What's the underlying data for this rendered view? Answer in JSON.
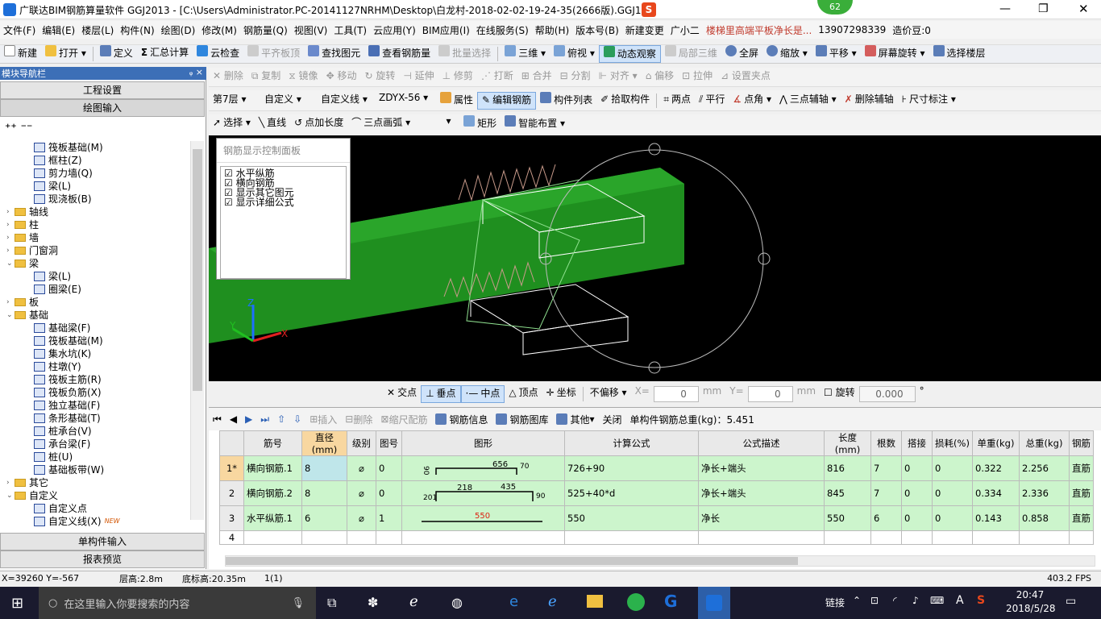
{
  "window": {
    "title": "广联达BIM钢筋算量软件 GGJ2013 - [C:\\Users\\Administrator.PC-20141127NRHM\\Desktop\\白龙村-2018-02-02-19-24-35(2666版).GGJ12]",
    "badge": "62"
  },
  "menu": [
    "文件(F)",
    "编辑(E)",
    "楼层(L)",
    "构件(N)",
    "绘图(D)",
    "修改(M)",
    "钢筋量(Q)",
    "视图(V)",
    "工具(T)",
    "云应用(Y)",
    "BIM应用(I)",
    "在线服务(S)",
    "帮助(H)",
    "版本号(B)",
    "新建变更",
    "广小二",
    "楼梯里高端平板净长是...",
    "13907298339",
    "造价豆:0"
  ],
  "toolbar1": [
    "新建",
    "打开",
    "定义",
    "汇总计算",
    "云检查",
    "平齐板顶",
    "查找图元",
    "查看钢筋量",
    "批量选择",
    "三维",
    "俯视",
    "动态观察",
    "局部三维",
    "全屏",
    "缩放",
    "平移",
    "屏幕旋转",
    "选择楼层"
  ],
  "toolbar2": [
    "删除",
    "复制",
    "镜像",
    "移动",
    "旋转",
    "延伸",
    "修剪",
    "打断",
    "合并",
    "分割",
    "对齐",
    "偏移",
    "拉伸",
    "设置夹点"
  ],
  "toolbar3": {
    "floor": "第7层",
    "type1": "自定义",
    "type2": "自定义线",
    "code": "ZDYX-56",
    "items": [
      "属性",
      "编辑钢筋",
      "构件列表",
      "拾取构件",
      "两点",
      "平行",
      "点角",
      "三点辅轴",
      "删除辅轴",
      "尺寸标注"
    ]
  },
  "toolbar4": [
    "选择",
    "直线",
    "点加长度",
    "三点画弧",
    "矩形",
    "智能布置"
  ],
  "leftpanel": {
    "header": "模块导航栏",
    "pin": "ᵩ ×",
    "tabs": [
      "工程设置",
      "绘图输入",
      "单构件输入",
      "报表预览"
    ],
    "tree": [
      {
        "label": "筏板基础(M)",
        "lvl": 3,
        "type": "leaf"
      },
      {
        "label": "框柱(Z)",
        "lvl": 3,
        "type": "leaf"
      },
      {
        "label": "剪力墙(Q)",
        "lvl": 3,
        "type": "leaf"
      },
      {
        "label": "梁(L)",
        "lvl": 3,
        "type": "leaf"
      },
      {
        "label": "现浇板(B)",
        "lvl": 3,
        "type": "leaf"
      },
      {
        "label": "轴线",
        "lvl": 1,
        "type": "folder",
        "exp": "›"
      },
      {
        "label": "柱",
        "lvl": 1,
        "type": "folder",
        "exp": "›"
      },
      {
        "label": "墙",
        "lvl": 1,
        "type": "folder",
        "exp": "›"
      },
      {
        "label": "门窗洞",
        "lvl": 1,
        "type": "folder",
        "exp": "›"
      },
      {
        "label": "梁",
        "lvl": 1,
        "type": "folder",
        "exp": "⌄"
      },
      {
        "label": "梁(L)",
        "lvl": 2,
        "type": "leaf"
      },
      {
        "label": "圈梁(E)",
        "lvl": 2,
        "type": "leaf"
      },
      {
        "label": "板",
        "lvl": 1,
        "type": "folder",
        "exp": "›"
      },
      {
        "label": "基础",
        "lvl": 1,
        "type": "folder",
        "exp": "⌄"
      },
      {
        "label": "基础梁(F)",
        "lvl": 2,
        "type": "leaf"
      },
      {
        "label": "筏板基础(M)",
        "lvl": 2,
        "type": "leaf"
      },
      {
        "label": "集水坑(K)",
        "lvl": 2,
        "type": "leaf"
      },
      {
        "label": "柱墩(Y)",
        "lvl": 2,
        "type": "leaf"
      },
      {
        "label": "筏板主筋(R)",
        "lvl": 2,
        "type": "leaf"
      },
      {
        "label": "筏板负筋(X)",
        "lvl": 2,
        "type": "leaf"
      },
      {
        "label": "独立基础(F)",
        "lvl": 2,
        "type": "leaf"
      },
      {
        "label": "条形基础(T)",
        "lvl": 2,
        "type": "leaf"
      },
      {
        "label": "桩承台(V)",
        "lvl": 2,
        "type": "leaf"
      },
      {
        "label": "承台梁(F)",
        "lvl": 2,
        "type": "leaf"
      },
      {
        "label": "桩(U)",
        "lvl": 2,
        "type": "leaf"
      },
      {
        "label": "基础板带(W)",
        "lvl": 2,
        "type": "leaf"
      },
      {
        "label": "其它",
        "lvl": 1,
        "type": "folder",
        "exp": "›"
      },
      {
        "label": "自定义",
        "lvl": 1,
        "type": "folder",
        "exp": "⌄"
      },
      {
        "label": "自定义点",
        "lvl": 2,
        "type": "leaf"
      },
      {
        "label": "自定义线(X)",
        "lvl": 2,
        "type": "leaf",
        "new": "NEW"
      }
    ]
  },
  "control_panel": {
    "title": "钢筋显示控制面板",
    "items": [
      "水平纵筋",
      "横向钢筋",
      "显示其它图元",
      "显示详细公式"
    ]
  },
  "snap": {
    "items": [
      "交点",
      "垂点",
      "中点",
      "顶点",
      "坐标"
    ],
    "offset": "不偏移",
    "x_label": "X=",
    "x": "0",
    "y_label": "Y=",
    "y": "0",
    "unit": "mm",
    "rotate": "旋转",
    "rotate_val": "0.000",
    "deg": "°"
  },
  "rebar": {
    "tools": [
      "插入",
      "删除",
      "缩尺配筋",
      "钢筋信息",
      "钢筋图库",
      "其他",
      "关闭"
    ],
    "total": "单构件钢筋总重(kg)：5.451",
    "columns": [
      "筋号",
      "直径(mm)",
      "级别",
      "图号",
      "图形",
      "计算公式",
      "公式描述",
      "长度(mm)",
      "根数",
      "搭接",
      "损耗(%)",
      "单重(kg)",
      "总重(kg)",
      "钢筋"
    ],
    "rows": [
      {
        "rn": "1*",
        "name": "横向钢筋.1",
        "dia": "8",
        "grade": "⌀",
        "fig": "0",
        "shape_a": "90",
        "shape_b": "656",
        "shape_c": "70",
        "formula": "726+90",
        "desc": "净长+端头",
        "len": "816",
        "count": "7",
        "lap": "0",
        "loss": "0",
        "unit": "0.322",
        "total": "2.256",
        "type": "直筋"
      },
      {
        "rn": "2",
        "name": "横向钢筋.2",
        "dia": "8",
        "grade": "⌀",
        "fig": "0",
        "shape_a": "201",
        "shape_b": "218",
        "shape_c": "435",
        "shape_d": "90",
        "formula": "525+40*d",
        "desc": "净长+端头",
        "len": "845",
        "count": "7",
        "lap": "0",
        "loss": "0",
        "unit": "0.334",
        "total": "2.336",
        "type": "直筋"
      },
      {
        "rn": "3",
        "name": "水平纵筋.1",
        "dia": "6",
        "grade": "⌀",
        "fig": "1",
        "shape_b": "550",
        "formula": "550",
        "desc": "净长",
        "len": "550",
        "count": "6",
        "lap": "0",
        "loss": "0",
        "unit": "0.143",
        "total": "0.858",
        "type": "直筋"
      },
      {
        "rn": "4"
      }
    ]
  },
  "status": {
    "coords": "X=39260 Y=-567",
    "floor_h": "层高:2.8m",
    "bottom_h": "底标高:20.35m",
    "count": "1(1)",
    "fps": "403.2 FPS"
  },
  "taskbar": {
    "search": "在这里输入你要搜索的内容",
    "link": "链接",
    "ime": "A",
    "time": "20:47",
    "date": "2018/5/28"
  }
}
